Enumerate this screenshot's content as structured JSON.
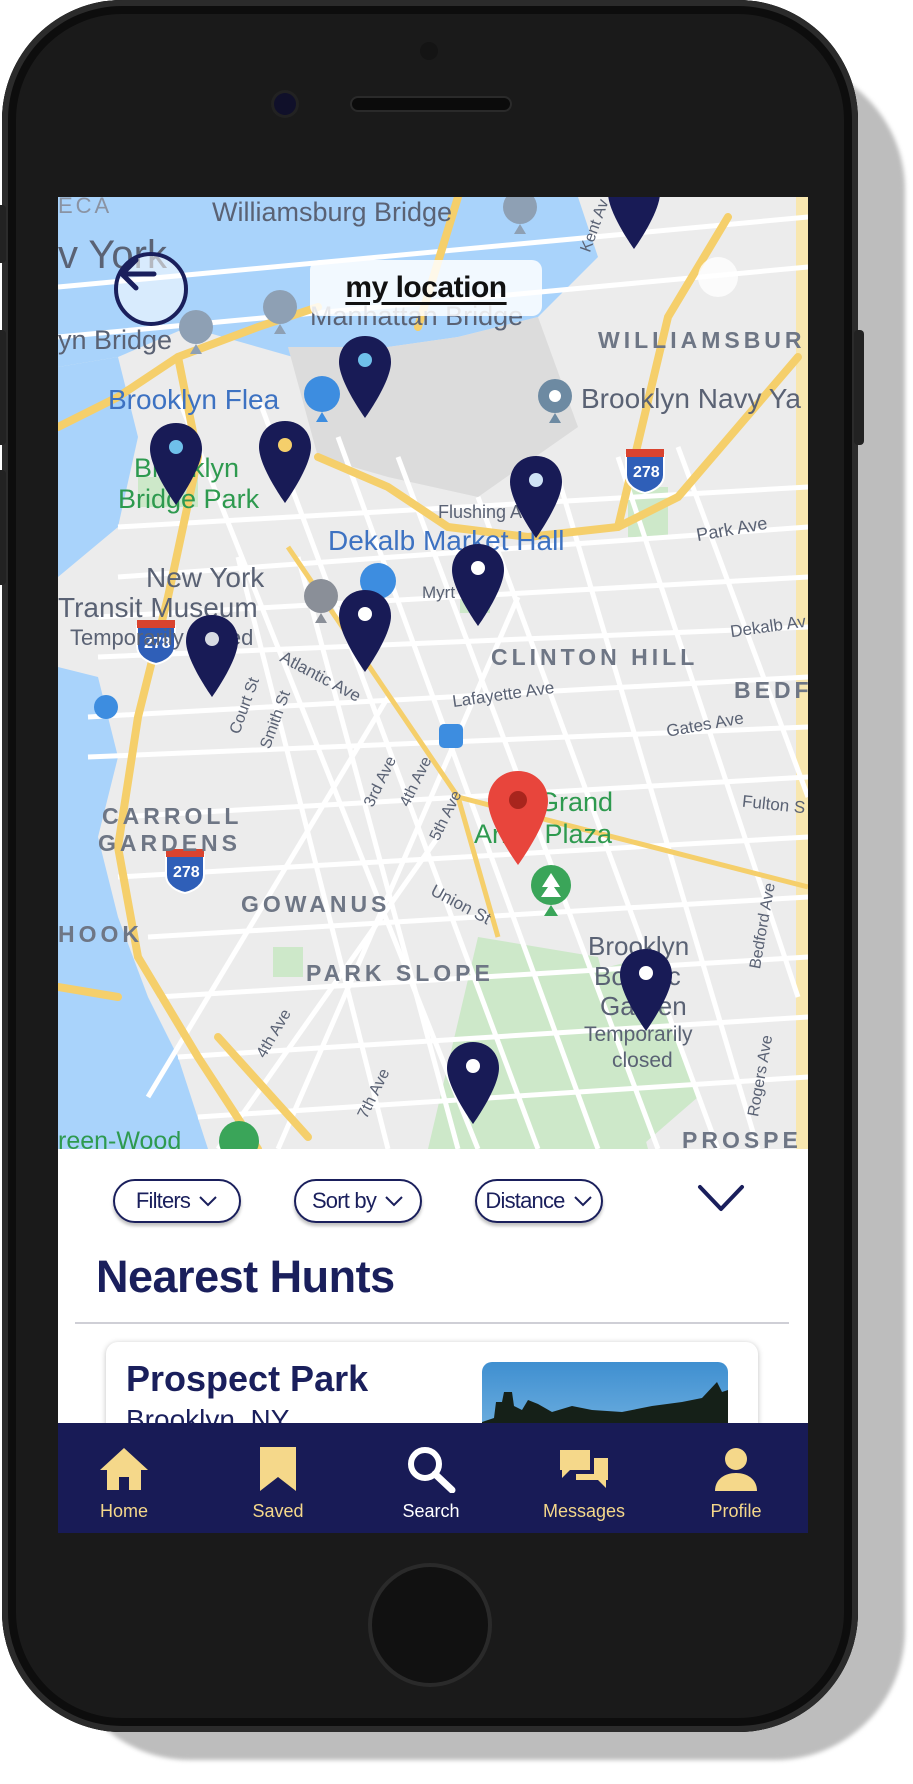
{
  "header": {
    "title": "my location",
    "back_icon": "arrow-left-icon"
  },
  "map": {
    "labels": {
      "williamsburg_bridge": "Williamsburg Bridge",
      "manhattan_bridge": "Manhattan Bridge",
      "york_fragment": "v York",
      "eca_fragment": "ECA",
      "n_bridge_fragment": "yn Bridge",
      "williamsburg": "WILLIAMSBUR",
      "brooklyn_flea": "Brooklyn Flea",
      "brooklyn_navy": "Brooklyn Navy Ya",
      "brooklyn_bridge_park_1": "Brooklyn",
      "brooklyn_bridge_park_2": "Bridge Park",
      "flushing_ave": "Flushing Av",
      "park_ave": "Park Ave",
      "dekalb_market": "Dekalb Market Hall",
      "nyt_museum_1": "New York",
      "nyt_museum_2": "Transit Museum",
      "nyt_museum_3": "Temporarily closed",
      "myrtle": "Myrt",
      "clinton_hill": "CLINTON HILL",
      "dekalb_ave": "Dekalb Av",
      "atlantic_ave": "Atlantic Ave",
      "lafayette_ave": "Lafayette Ave",
      "court_st": "Court St",
      "smith_st": "Smith St",
      "bedf": "BEDF",
      "gates_ave": "Gates Ave",
      "carroll_1": "CARROLL",
      "carroll_2": "GARDENS",
      "third_ave": "3rd Ave",
      "fourth_ave": "4th Ave",
      "fifth_ave": "5th Ave",
      "grand_army_1": "Grand",
      "grand_army_2": "Army Plaza",
      "fulton": "Fulton S",
      "gowanus": "GOWANUS",
      "union_st": "Union St",
      "hook": "HOOK",
      "park_slope": "PARK SLOPE",
      "botanic_1": "Brooklyn",
      "botanic_2": "Botanic",
      "botanic_3": "Garden",
      "botanic_4": "Temporarily",
      "botanic_5": "closed",
      "bedford_ave": "Bedford Ave",
      "rogers_ave": "Rogers Ave",
      "fourth_ave_2": "4th Ave",
      "seventh_ave": "7th Ave",
      "green_wood": "reen-Wood",
      "prospect": "PROSPE",
      "kent_ave": "Kent Av",
      "hwy_278": "278"
    }
  },
  "filters": {
    "filters_label": "Filters",
    "sort_label": "Sort by",
    "distance_label": "Distance",
    "collapse_icon": "chevron-down-icon"
  },
  "list": {
    "title": "Nearest Hunts",
    "cards": [
      {
        "title": "Prospect Park",
        "subtitle": "Brooklyn, NY"
      }
    ]
  },
  "tabbar": {
    "items": [
      {
        "label": "Home",
        "icon": "home-icon",
        "color": "#f5d88a"
      },
      {
        "label": "Saved",
        "icon": "bookmark-icon",
        "color": "#f5d88a"
      },
      {
        "label": "Search",
        "icon": "search-icon",
        "color": "#ffffff"
      },
      {
        "label": "Messages",
        "icon": "messages-icon",
        "color": "#f5d88a"
      },
      {
        "label": "Profile",
        "icon": "profile-icon",
        "color": "#f5d88a"
      }
    ]
  },
  "colors": {
    "navy": "#1a1f5c",
    "pin_red": "#e8453c",
    "tab_active": "#ffffff",
    "tab_inactive": "#f5d88a"
  }
}
